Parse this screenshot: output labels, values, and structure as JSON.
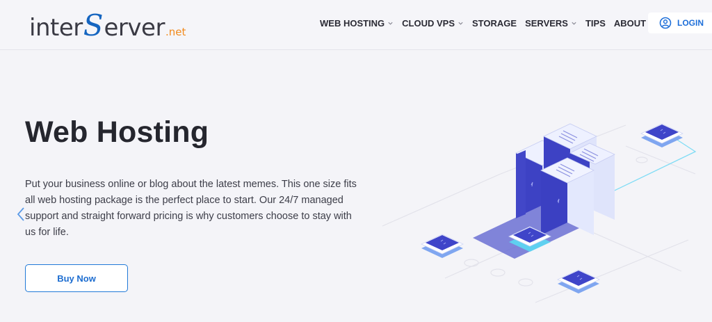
{
  "logo": {
    "part_a": "inter",
    "part_b": "S",
    "part_c": "erver",
    "part_d": ".net",
    "colors": {
      "text": "#3a3a44",
      "accent": "#1565c0",
      "suffix": "#f28a1c"
    }
  },
  "nav": {
    "items": [
      {
        "label": "WEB HOSTING",
        "has_dropdown": true
      },
      {
        "label": "CLOUD VPS",
        "has_dropdown": true
      },
      {
        "label": "STORAGE",
        "has_dropdown": false
      },
      {
        "label": "SERVERS",
        "has_dropdown": true
      },
      {
        "label": "TIPS",
        "has_dropdown": false
      },
      {
        "label": "ABOUT US",
        "has_dropdown": true
      }
    ],
    "login_label": "LOGIN",
    "login_icon": "user-circle-icon"
  },
  "hero": {
    "title": "Web Hosting",
    "description": "Put your business online or blog about the latest memes. This one size fits all web hosting package is the perfect place to start. Our 24/7 managed support and straight forward pricing is why customers choose to stay with us for life.",
    "button_label": "Buy Now",
    "prev_icon": "chevron-left-icon"
  },
  "illustration": {
    "icon": "server-rack-illustration",
    "colors": {
      "server_blue": "#3f45c9",
      "server_light": "#dfe6ff",
      "accent_cyan": "#5fd0f0"
    }
  }
}
